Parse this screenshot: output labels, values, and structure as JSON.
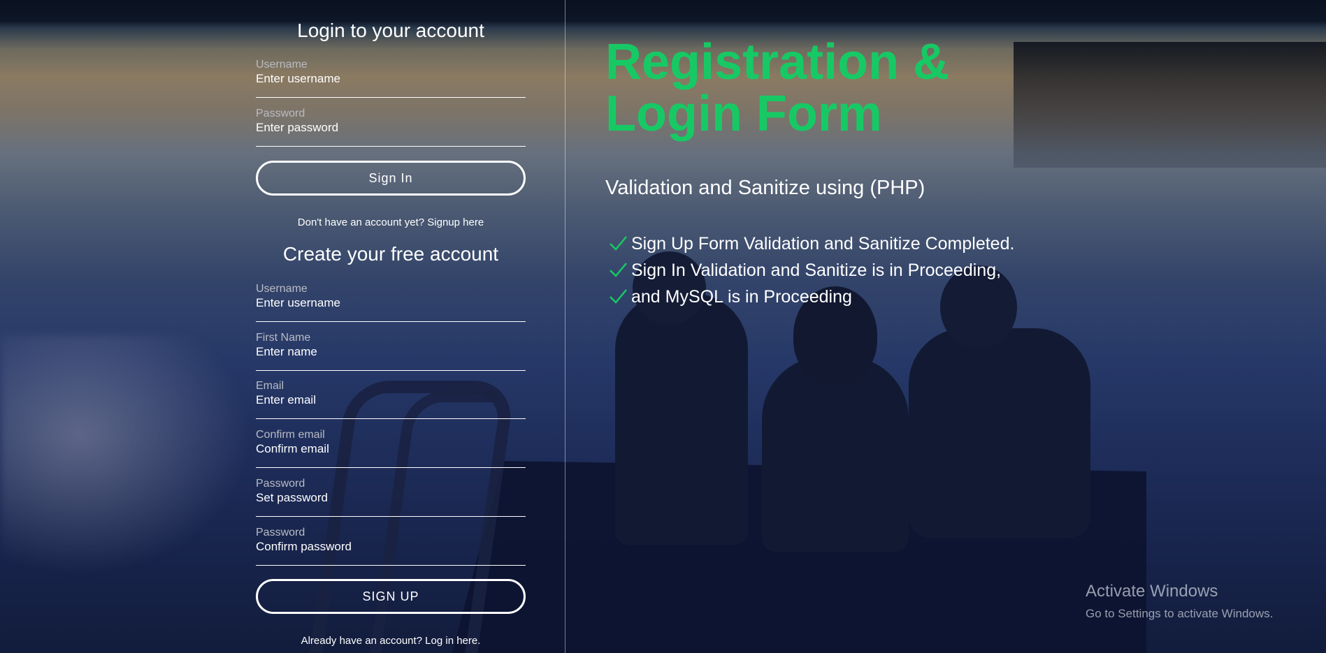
{
  "login": {
    "title": "Login to your account",
    "username": {
      "label": "Username",
      "placeholder": "Enter username"
    },
    "password": {
      "label": "Password",
      "placeholder": "Enter password"
    },
    "submit_label": "Sign In",
    "signup_prompt": "Don't have an account yet? Signup here"
  },
  "signup": {
    "title": "Create your free account",
    "fields": [
      {
        "label": "Username",
        "placeholder": "Enter username"
      },
      {
        "label": "First Name",
        "placeholder": "Enter name"
      },
      {
        "label": "Email",
        "placeholder": "Enter email"
      },
      {
        "label": "Confirm email",
        "placeholder": "Confirm email"
      },
      {
        "label": "Password",
        "placeholder": "Set password"
      },
      {
        "label": "Password",
        "placeholder": "Confirm password"
      }
    ],
    "submit_label": "SIGN UP",
    "login_prompt": "Already have an account? Log in here."
  },
  "hero": {
    "title_line1": "Registration &",
    "title_line2": "Login Form",
    "subtitle": "Validation and Sanitize using (PHP)",
    "checklist": [
      "Sign Up Form Validation and Sanitize Completed.",
      "Sign In Validation and Sanitize is in Proceeding,",
      "and MySQL is in Proceeding"
    ]
  },
  "watermark": {
    "line1": "Activate Windows",
    "line2": "Go to Settings to activate Windows."
  },
  "colors": {
    "accent": "#17c964",
    "text": "#ffffff",
    "label": "#b9bcc4"
  },
  "icons": {
    "check": "check-icon"
  }
}
